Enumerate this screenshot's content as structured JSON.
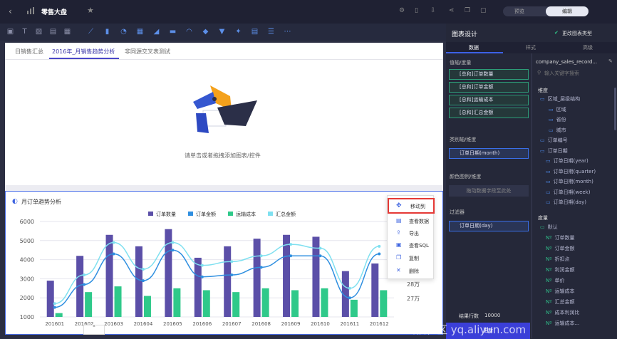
{
  "header": {
    "title": "零售大盘",
    "preview": "预览",
    "edit": "编辑"
  },
  "tabs": [
    "日销售汇总",
    "2016年_月销售趋势分析",
    "非同源交叉表测试"
  ],
  "empty_hint": "请单击或者拖拽添加图表/控件",
  "panel": {
    "title": "图表设计",
    "change_type": "更改图表类型",
    "tabs": [
      "数据",
      "样式",
      "高级"
    ],
    "value_label": "值轴/度量",
    "value_fields": [
      "[总和]订单数量",
      "[总和]订单金额",
      "[总和]运输成本",
      "[总和]汇总金额"
    ],
    "cat_label": "类别轴/维度",
    "cat_field": "订单日期(month)",
    "color_label": "颜色图例/维度",
    "color_hint": "拖动数据字段至此处",
    "filter_label": "过滤器",
    "filter_field": "订单日期(day)",
    "result_label": "结果行数",
    "result_value": "10000",
    "update": "更新"
  },
  "dataset": {
    "name": "company_sales_record...",
    "search_placeholder": "输入关键字搜索",
    "dim_label": "维度",
    "dim_items": [
      "区域_层级结构",
      "区域",
      "省份",
      "城市",
      "订单编号",
      "订单日期",
      "订单日期(year)",
      "订单日期(quarter)",
      "订单日期(month)",
      "订单日期(week)",
      "订单日期(day)"
    ],
    "measure_label": "度量",
    "measure_items": [
      "默认",
      "订单数量",
      "订单金额",
      "折扣点",
      "利润金额",
      "单价",
      "运输成本",
      "汇总金额",
      "成本利润比",
      "运输成本..."
    ]
  },
  "menu": [
    "移动到",
    "查看数据",
    "导出",
    "查看SQL",
    "复制",
    "删除"
  ],
  "watermark": "云栖社区 yq.aliyun.com",
  "chart_data": {
    "type": "bar",
    "title": "月订单趋势分析",
    "categories": [
      "201601",
      "201602",
      "201603",
      "201604",
      "201605",
      "201606",
      "201607",
      "201608",
      "201609",
      "201610",
      "201611",
      "201612"
    ],
    "series": [
      {
        "name": "订单数量",
        "type": "bar",
        "color": "#5b4fa8",
        "values": [
          2900,
          4200,
          5300,
          4700,
          5600,
          4100,
          4700,
          5100,
          5300,
          5200,
          3400,
          3800
        ]
      },
      {
        "name": "订单金额",
        "type": "line",
        "color": "#2f8fe0",
        "values": [
          1500,
          2700,
          4300,
          2900,
          4500,
          3100,
          3200,
          3600,
          4200,
          4200,
          2000,
          4300
        ]
      },
      {
        "name": "运输成本",
        "type": "bar",
        "color": "#2fc98a",
        "values": [
          1200,
          2300,
          2600,
          2100,
          2500,
          2400,
          2300,
          2500,
          2400,
          2500,
          1900,
          2400
        ]
      },
      {
        "name": "汇总金额",
        "type": "line",
        "color": "#7fe0f0",
        "values": [
          1700,
          3200,
          4900,
          3500,
          4900,
          3700,
          3900,
          4200,
          4800,
          4600,
          2500,
          4700
        ]
      }
    ],
    "ylim": [
      1000,
      6000
    ],
    "yticks": [
      "1000",
      "2000",
      "3000",
      "4000",
      "5000",
      "6000"
    ],
    "y2ticks": [
      "28万",
      "27万"
    ]
  }
}
